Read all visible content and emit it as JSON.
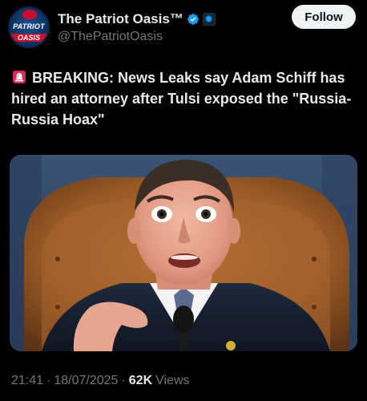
{
  "author": {
    "display_name": "The Patriot Oasis™",
    "handle": "@ThePatriotOasis",
    "avatar_text_top": "PATRIOT",
    "avatar_text_bottom": "OASIS",
    "verified_icon": "verified-badge-icon",
    "affiliate_icon": "affiliate-badge-icon"
  },
  "follow_label": "Follow",
  "post": {
    "icon": "siren-icon",
    "text": "BREAKING: News Leaks say Adam Schiff has hired an attorney after Tulsi exposed the \"Russia-Russia Hoax\""
  },
  "meta": {
    "time": "21:41",
    "date": "18/07/2025",
    "views_count": "62K",
    "views_label": "Views",
    "separator": "·"
  },
  "colors": {
    "background": "#000000",
    "text_primary": "#e7e9ea",
    "text_secondary": "#71767b",
    "verified_blue": "#1d9bf0",
    "follow_bg": "#eff3f4",
    "siren_red": "#e0245e"
  }
}
